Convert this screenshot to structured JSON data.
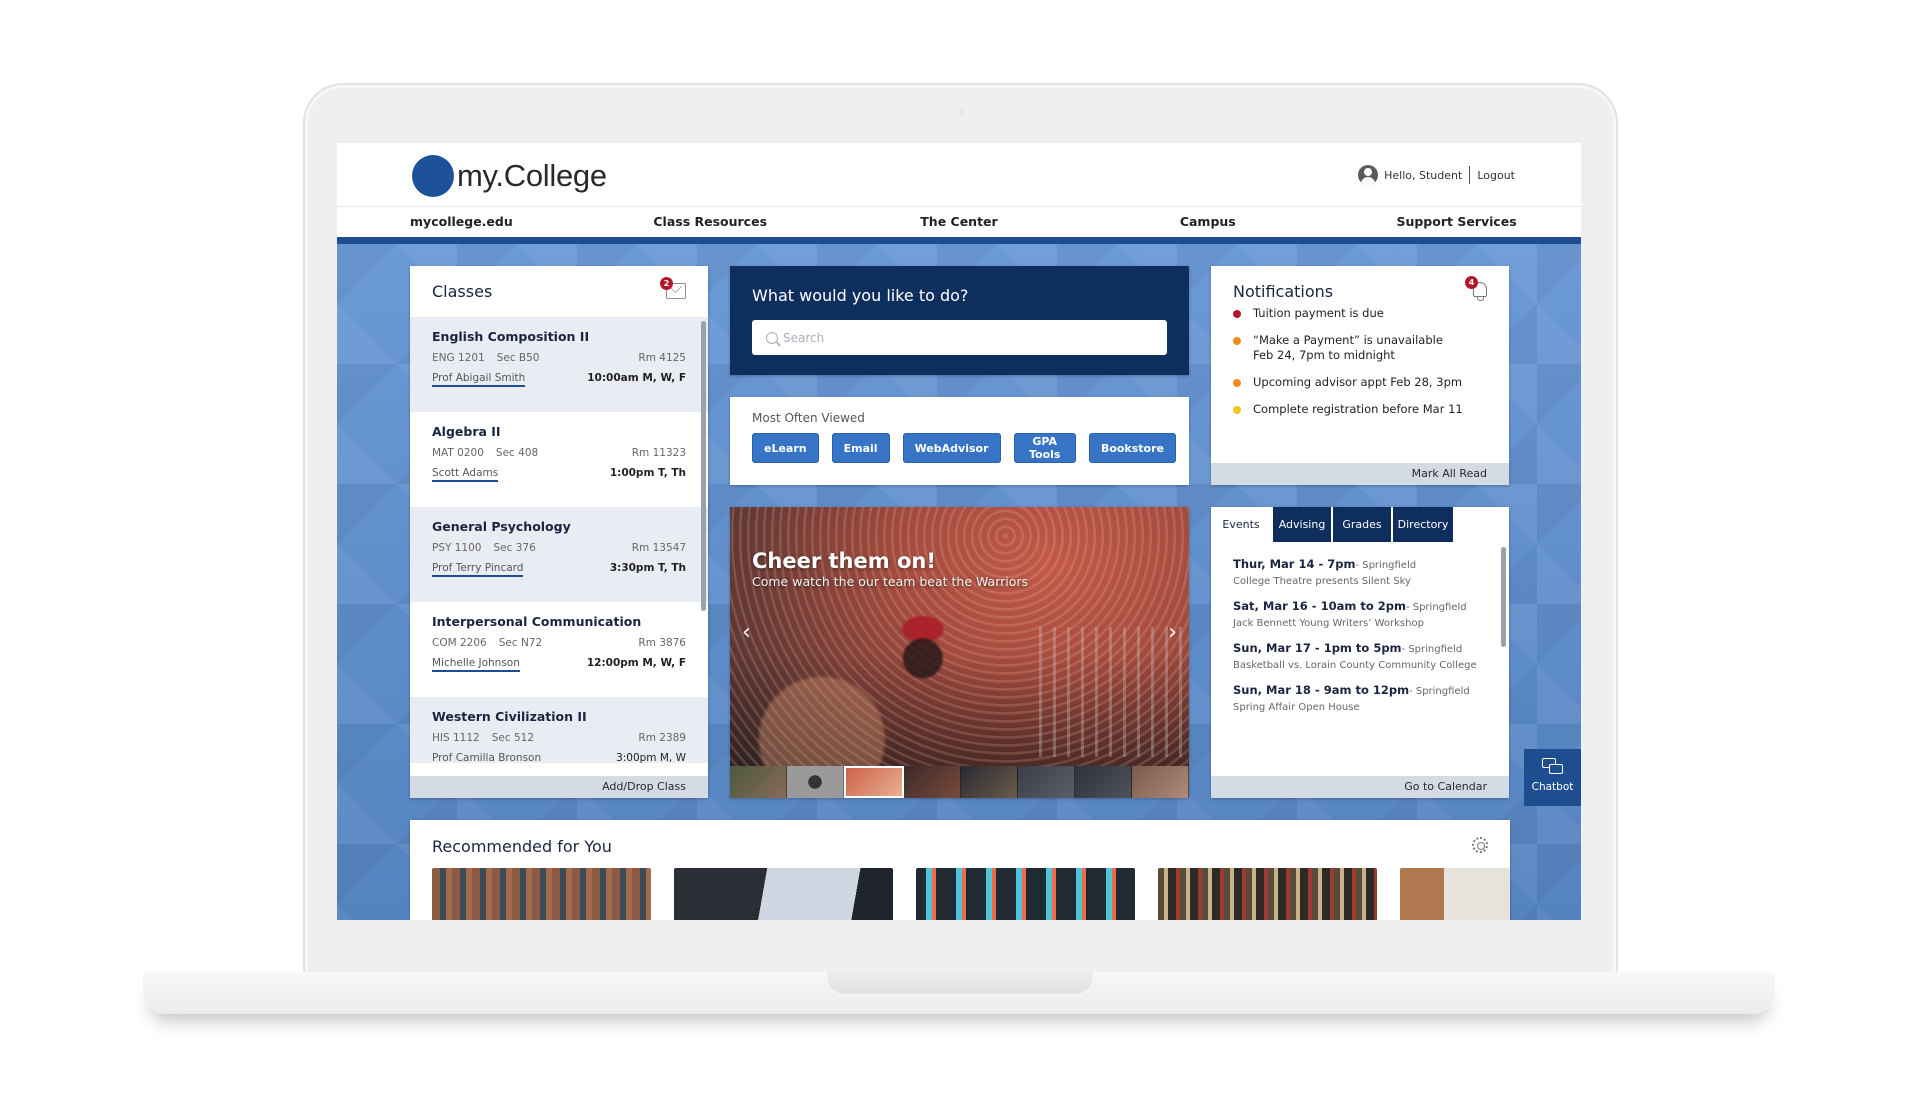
{
  "header": {
    "logo_text": "my.College",
    "greeting": "Hello, Student",
    "logout_label": "Logout"
  },
  "nav": {
    "items": [
      "mycollege.edu",
      "Class Resources",
      "The Center",
      "Campus",
      "Support Services"
    ]
  },
  "classes": {
    "title": "Classes",
    "mail_badge": "2",
    "items": [
      {
        "name": "English Composition II",
        "code": "ENG 1201",
        "section": "Sec B50",
        "room": "Rm 4125",
        "professor": "Prof Abigail Smith",
        "time": "10:00am M, W, F"
      },
      {
        "name": "Algebra II",
        "code": "MAT 0200",
        "section": "Sec 408",
        "room": "Rm 11323",
        "professor": "Scott Adams",
        "time": "1:00pm T, Th"
      },
      {
        "name": "General Psychology",
        "code": "PSY 1100",
        "section": "Sec 376",
        "room": "Rm 13547",
        "professor": "Prof Terry Pincard",
        "time": "3:30pm T, Th"
      },
      {
        "name": "Interpersonal Communication",
        "code": "COM 2206",
        "section": "Sec N72",
        "room": "Rm 3876",
        "professor": "Michelle Johnson",
        "time": "12:00pm M, W, F"
      },
      {
        "name": "Western Civilization II",
        "code": "HIS 1112",
        "section": "Sec 512",
        "room": "Rm 2389",
        "professor": "Prof Camilla Bronson",
        "time": "3:00pm M, W"
      }
    ],
    "footer_link": "Add/Drop Class"
  },
  "search": {
    "title": "What would you like to do?",
    "placeholder": "Search",
    "value": ""
  },
  "most_viewed": {
    "title": "Most Often Viewed",
    "buttons": [
      "eLearn",
      "Email",
      "WebAdvisor",
      "GPA Tools",
      "Bookstore"
    ]
  },
  "carousel": {
    "title": "Cheer them on!",
    "subtitle": "Come watch the our team beat the Warriors",
    "prev_icon": "‹",
    "next_icon": "›",
    "thumbnail_count": 8,
    "active_thumbnail": 3
  },
  "notifications": {
    "title": "Notifications",
    "badge": "4",
    "items": [
      {
        "text": "Tuition payment is due",
        "color": "#b3162a"
      },
      {
        "text": "“Make a Payment” is unavailable\n Feb 24, 7pm to midnight",
        "color": "#f28c1e"
      },
      {
        "text": "Upcoming advisor appt Feb 28, 3pm",
        "color": "#f28c1e"
      },
      {
        "text": "Complete registration before Mar 11",
        "color": "#f5c518"
      }
    ],
    "footer_link": "Mark All Read"
  },
  "events_panel": {
    "tabs": [
      "Events",
      "Advising",
      "Grades",
      "Directory"
    ],
    "active_tab": "Events",
    "events": [
      {
        "when": "Thur, Mar 14 - 7pm",
        "where": "- Springfield",
        "what": "College Theatre presents Silent Sky"
      },
      {
        "when": "Sat, Mar 16 - 10am to 2pm",
        "where": "- Springfield",
        "what": "Jack Bennett Young Writers’ Workshop"
      },
      {
        "when": "Sun, Mar 17 - 1pm to 5pm",
        "where": "- Springfield",
        "what": "Basketball vs. Lorain County Community College"
      },
      {
        "when": "Sun, Mar 18 - 9am to 12pm",
        "where": "- Springfield",
        "what": "Spring Affair Open House"
      }
    ],
    "footer_link": "Go to Calendar"
  },
  "chatbot": {
    "label": "Chatbot"
  },
  "recommended": {
    "title": "Recommended for You",
    "cards": [
      "lecture-hall",
      "presentation",
      "sticky-note-wall",
      "library-stacks",
      "street-portrait"
    ]
  },
  "colors": {
    "brand_blue": "#1d5199",
    "navy": "#0e2f5e",
    "button_blue": "#3774c5",
    "background_blue": "#6093d0"
  }
}
